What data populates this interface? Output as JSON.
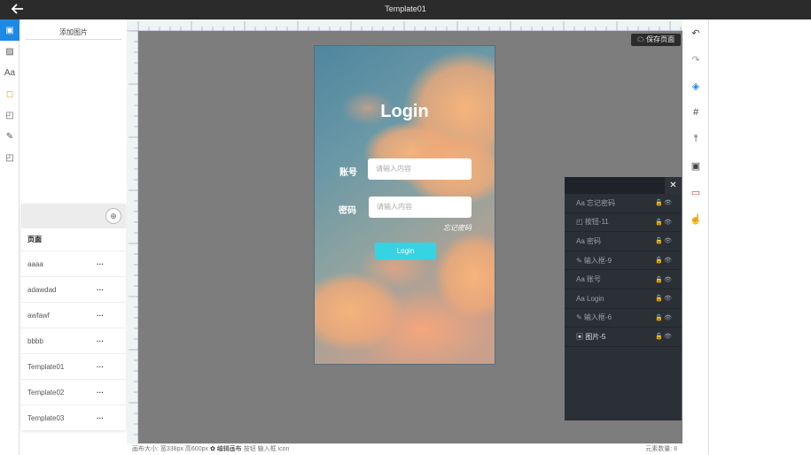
{
  "topbar": {
    "title": "Template01",
    "back_icon": "arrow-left-icon"
  },
  "left_tools": [
    {
      "name": "image-tool",
      "glyph": "▣",
      "active": true
    },
    {
      "name": "pattern-tool",
      "glyph": "▨",
      "active": false
    },
    {
      "name": "text-tool",
      "glyph": "Aa",
      "active": false
    },
    {
      "name": "button-tool",
      "glyph": "◻",
      "active": false
    },
    {
      "name": "component-tool",
      "glyph": "◰",
      "active": false
    },
    {
      "name": "input-tool",
      "glyph": "✎",
      "active": false
    },
    {
      "name": "box-tool",
      "glyph": "◰",
      "active": false
    }
  ],
  "panel": {
    "add_image_label": "添加图片"
  },
  "pages": {
    "title": "页面",
    "add_glyph": "⊕",
    "items": [
      "aaaa",
      "adawdad",
      "awfawf",
      "bbbb",
      "Template01",
      "Template02",
      "Template03"
    ],
    "more_glyph": "···"
  },
  "canvas": {
    "save_label": "☁ 保存页面"
  },
  "phone": {
    "login_title": "Login",
    "account_label": "账号",
    "account_placeholder": "请输入内容",
    "password_label": "密码",
    "password_placeholder": "请输入内容",
    "forgot_label": "忘记密码",
    "login_button": "Login"
  },
  "layers": {
    "close_glyph": "✕",
    "items": [
      {
        "label": "Aa 忘记密码",
        "selected": false
      },
      {
        "label": "◰ 按钮-11",
        "selected": false
      },
      {
        "label": "Aa 密码",
        "selected": false
      },
      {
        "label": "✎ 输入框-9",
        "selected": false
      },
      {
        "label": "Aa 账号",
        "selected": false
      },
      {
        "label": "Aa Login",
        "selected": false
      },
      {
        "label": "✎ 输入框-6",
        "selected": false
      },
      {
        "label": "▣ 图片-5",
        "selected": true
      }
    ],
    "icons_glyph": "🔓👁"
  },
  "right_tools": [
    {
      "name": "undo-icon",
      "glyph": "↶",
      "style": ""
    },
    {
      "name": "redo-icon",
      "glyph": "↷",
      "style": "grey"
    },
    {
      "name": "layers-icon",
      "glyph": "◈",
      "style": "blue"
    },
    {
      "name": "grid-icon",
      "glyph": "#",
      "style": ""
    },
    {
      "name": "upload-icon",
      "glyph": "⤒",
      "style": ""
    },
    {
      "name": "image-icon",
      "glyph": "▣",
      "style": ""
    },
    {
      "name": "monitor-icon",
      "glyph": "▭",
      "style": "red"
    },
    {
      "name": "hand-icon",
      "glyph": "☝",
      "style": ""
    }
  ],
  "statusbar": {
    "size_text": "画布大小: 宽338px 高600px",
    "edit_label": "✿ 编辑画布",
    "items": "按钮  输入框  icon",
    "right_text": "元素数量: 8"
  }
}
